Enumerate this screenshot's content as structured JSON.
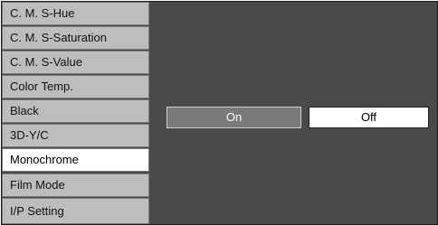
{
  "menu": {
    "items": [
      {
        "label": "C. M. S-Hue"
      },
      {
        "label": "C. M. S-Saturation"
      },
      {
        "label": "C. M. S-Value"
      },
      {
        "label": "Color Temp."
      },
      {
        "label": "Black"
      },
      {
        "label": "3D-Y/C"
      },
      {
        "label": "Monochrome"
      },
      {
        "label": "Film Mode"
      },
      {
        "label": "I/P Setting"
      }
    ],
    "selected": "Monochrome"
  },
  "options": {
    "on_label": "On",
    "off_label": "Off",
    "current": "Off"
  },
  "colors": {
    "panel_bg": "#4a4a4a",
    "menu_item_bg": "#bdbdbd",
    "selected_bg": "#ffffff",
    "on_button_bg": "#7a7a7a"
  }
}
